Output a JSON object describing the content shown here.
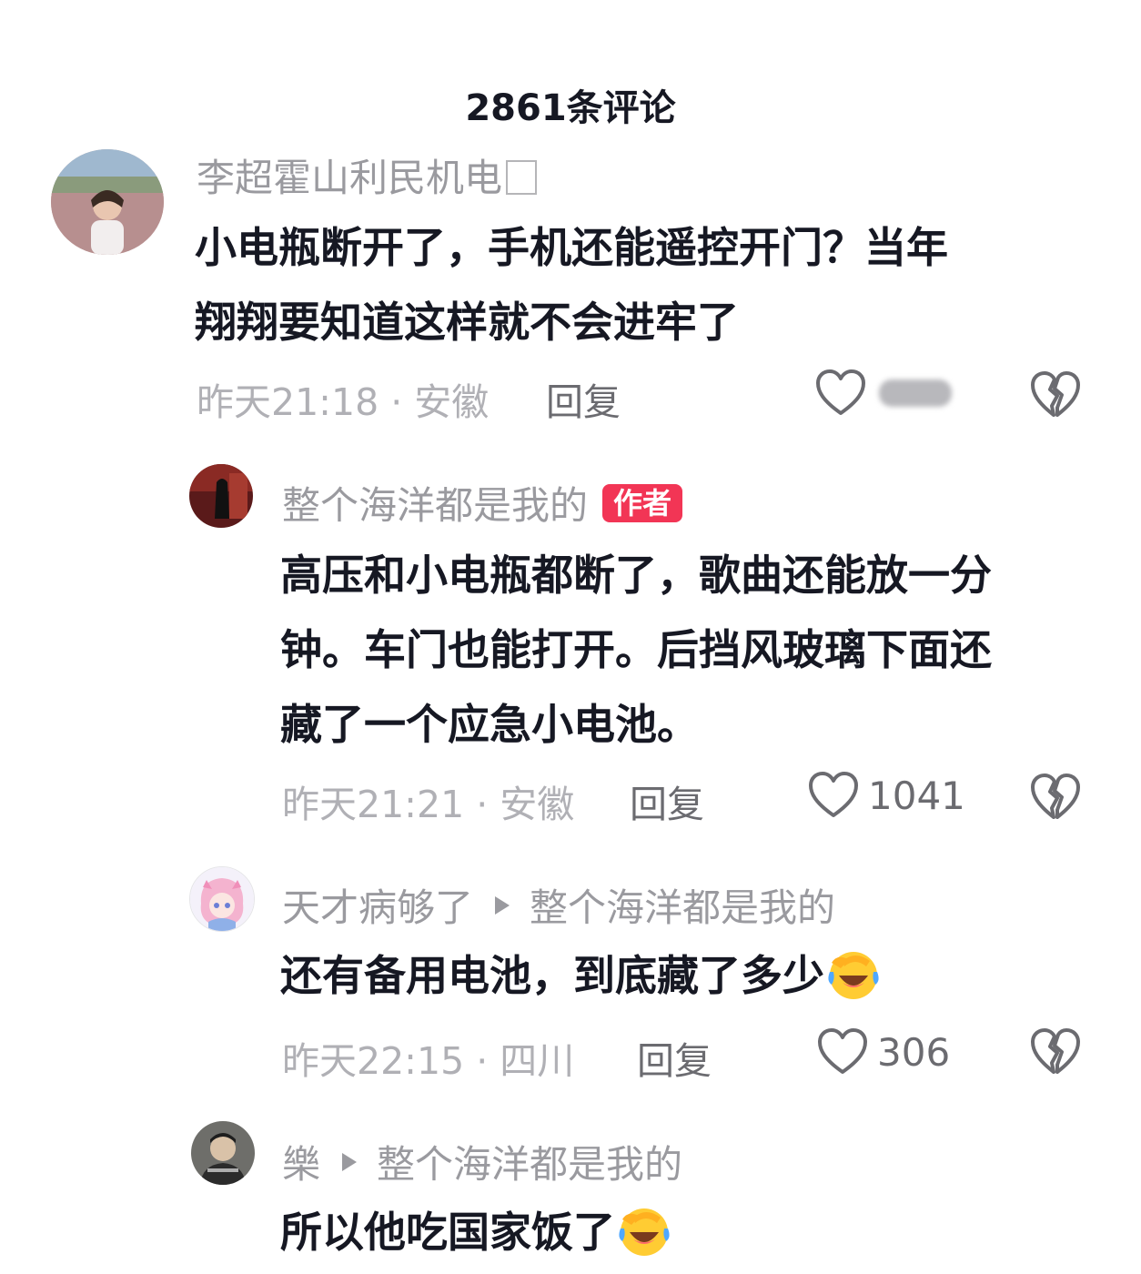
{
  "header": {
    "title": "2861条评论"
  },
  "comments": [
    {
      "username": "李超霍山利民机电",
      "lines": [
        "小电瓶断开了，手机还能遥控开门？当年",
        "翔翔要知道这样就不会进牢了"
      ],
      "meta": "昨天21:18 · 安徽",
      "reply": "回复",
      "likes": ""
    },
    {
      "username": "整个海洋都是我的",
      "badge": "作者",
      "lines": [
        "高压和小电瓶都断了，歌曲还能放一分",
        "钟。车门也能打开。后挡风玻璃下面还",
        "藏了一个应急小电池。"
      ],
      "meta": "昨天21:21 · 安徽",
      "reply": "回复",
      "likes": "1041"
    },
    {
      "username": "天才病够了",
      "reply_to": "整个海洋都是我的",
      "text": "还有备用电池，到底藏了多少",
      "meta": "昨天22:15 · 四川",
      "reply": "回复",
      "likes": "306"
    },
    {
      "username": "樂",
      "reply_to": "整个海洋都是我的",
      "text": "所以他吃国家饭了"
    }
  ],
  "icons": {
    "like": "heart-outline-icon",
    "dislike": "broken-heart-icon",
    "emoji": "laughing-crying-emoji"
  },
  "colors": {
    "badge": "#f23555",
    "text": "#161823",
    "muted": "#9a9a9f"
  }
}
